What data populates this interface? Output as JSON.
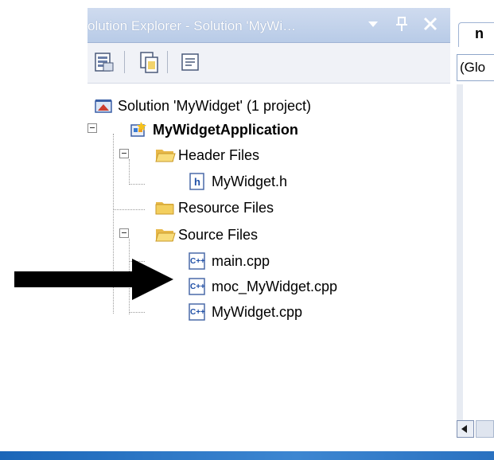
{
  "panel": {
    "title": "Solution Explorer - Solution 'MyWi… ▾ ⊥ ✕",
    "title_text": "olution Explorer - Solution 'MyWi…"
  },
  "toolbar": {
    "buttons": [
      "properties-icon",
      "show-all-files-icon",
      "view-class-diagram-icon"
    ]
  },
  "tree": {
    "solution": "Solution 'MyWidget' (1 project)",
    "project": "MyWidgetApplication",
    "header_files": "Header Files",
    "mywidget_h": "MyWidget.h",
    "resource_files": "Resource Files",
    "source_files": "Source Files",
    "main_cpp": "main.cpp",
    "moc_cpp": "moc_MyWidget.cpp",
    "mywidget_cpp": "MyWidget.cpp"
  },
  "editor": {
    "tab_label": "n",
    "scope_value": "(Glo"
  },
  "colors": {
    "accent": "#2a71c0",
    "title_bg": "#c4d4ee"
  }
}
